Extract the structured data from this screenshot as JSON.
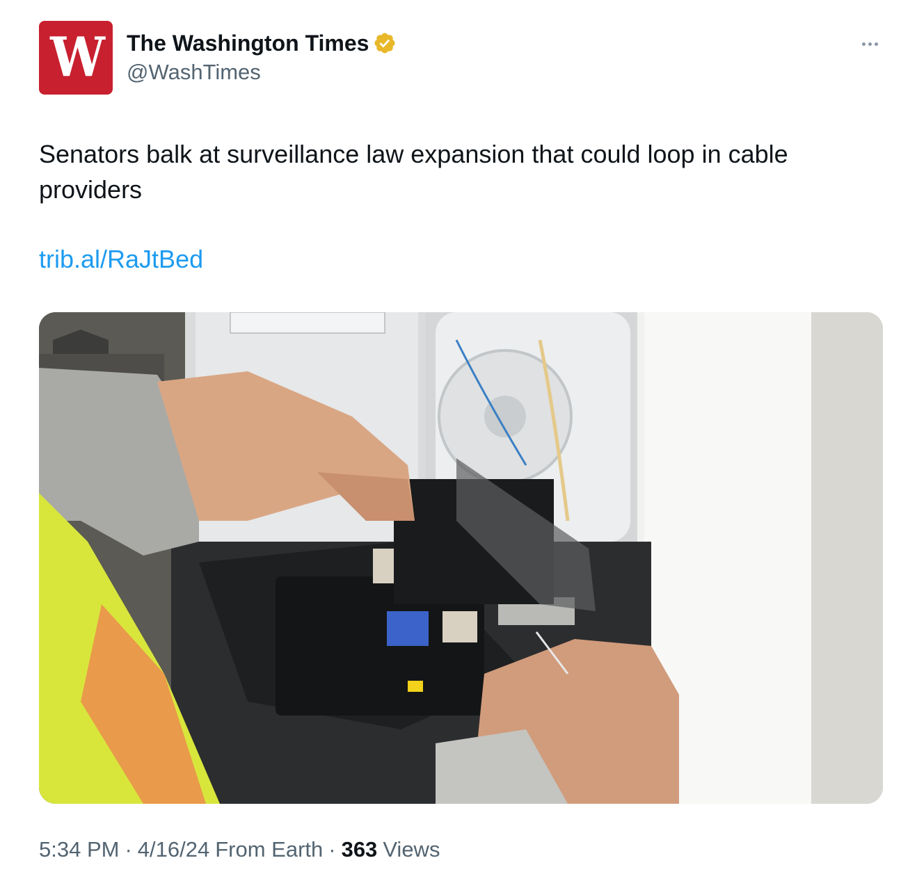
{
  "tweet": {
    "author": {
      "display_name": "The Washington Times",
      "handle": "@WashTimes",
      "logo_letter": "W",
      "verified": true,
      "badge_color": "#e8b829",
      "avatar_color": "#c8202f"
    },
    "text": "Senators balk at surveillance law expansion that could loop in cable providers",
    "link": "trib.al/RaJtBed",
    "media": {
      "icon": "photo-fiber-splicing-technician"
    },
    "meta": {
      "time": "5:34 PM",
      "separator": "·",
      "date": "4/16/24",
      "source": "From Earth",
      "views_count": "363",
      "views_label": "Views"
    },
    "more_icon": "more-options-icon"
  }
}
